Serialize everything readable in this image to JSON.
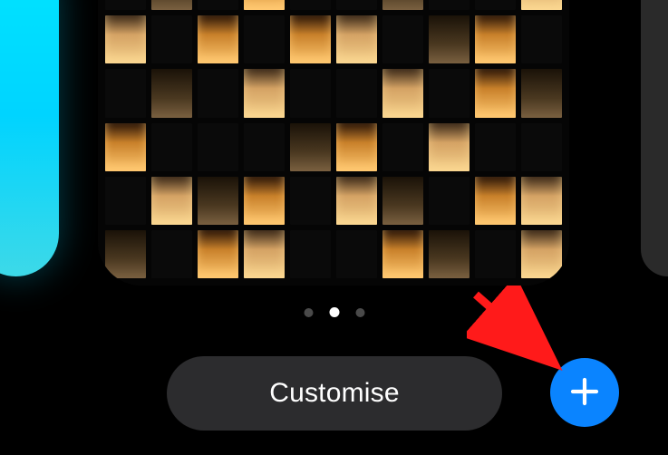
{
  "customise_label": "Customise",
  "page_indicator": {
    "total": 3,
    "active": 1
  },
  "add_button": {
    "icon_name": "plus"
  },
  "colors": {
    "accent_blue": "#0a84ff",
    "button_gray": "#2c2c2e",
    "background": "#000000",
    "prev_card_gradient_start": "#00e5ff",
    "prev_card_gradient_end": "#3dd9e8"
  },
  "annotation": {
    "arrow_color": "#ff0000",
    "points_to": "add-button"
  }
}
